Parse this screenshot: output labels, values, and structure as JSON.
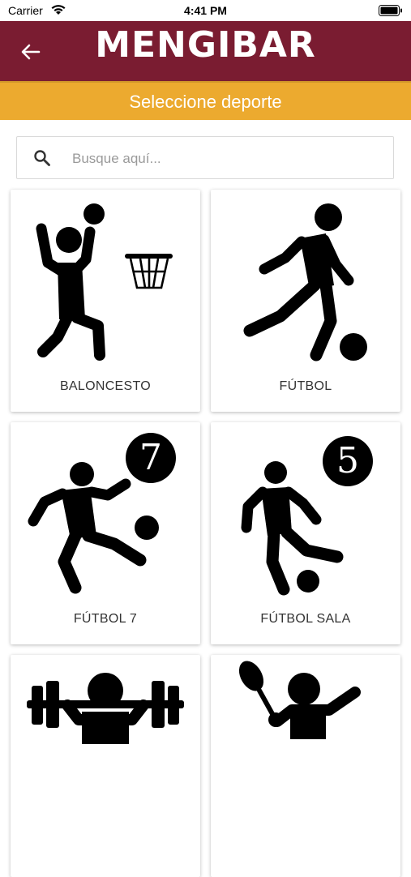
{
  "status_bar": {
    "carrier": "Carrier",
    "time": "4:41 PM"
  },
  "header": {
    "brand": "MENGIBAR",
    "back_icon": "arrow-left-icon"
  },
  "subheader": {
    "title": "Seleccione deporte"
  },
  "search": {
    "placeholder": "Busque aquí...",
    "value": ""
  },
  "sports": [
    {
      "label": "BALONCESTO",
      "icon": "basketball-player-icon"
    },
    {
      "label": "FÚTBOL",
      "icon": "soccer-player-icon"
    },
    {
      "label": "FÚTBOL 7",
      "icon": "football-7-icon",
      "badge": "7"
    },
    {
      "label": "FÚTBOL SALA",
      "icon": "futsal-icon",
      "badge": "5"
    },
    {
      "label": "",
      "icon": "weightlifting-icon"
    },
    {
      "label": "",
      "icon": "racket-sport-icon"
    }
  ],
  "colors": {
    "header": "#7a1c31",
    "accent": "#ecaa2f"
  }
}
